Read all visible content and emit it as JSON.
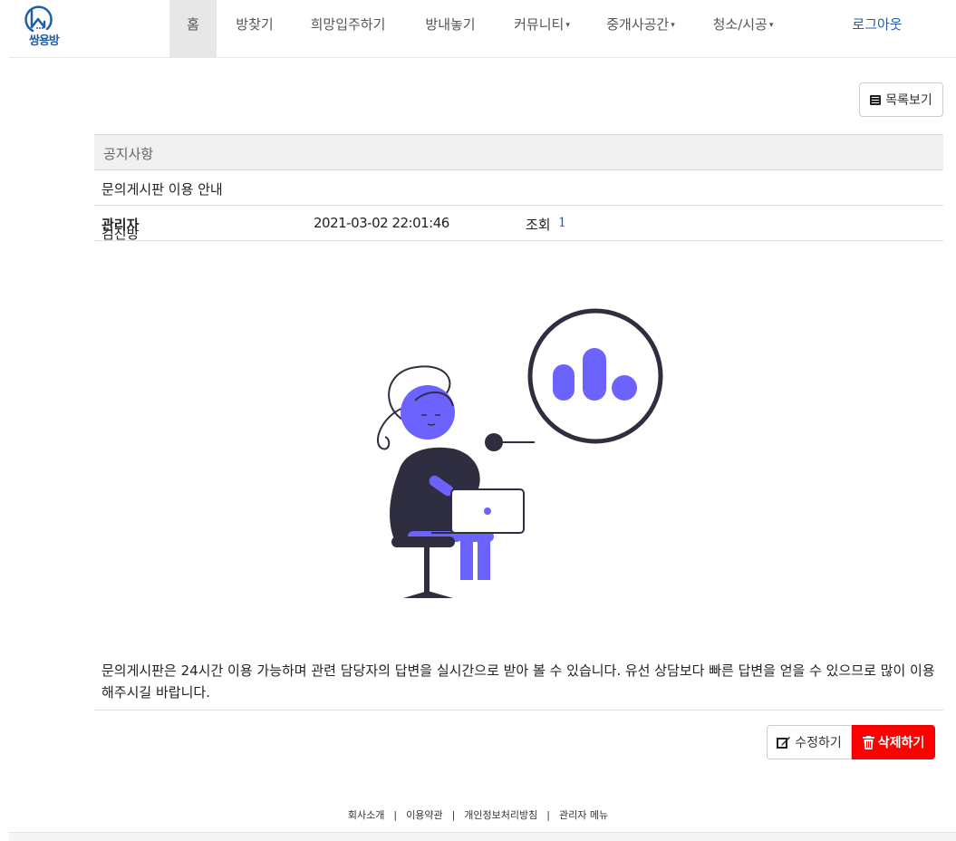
{
  "brand": {
    "name": "쌍용방",
    "accent": "#1f5fa8"
  },
  "nav": {
    "home": "홈",
    "find_room": "방찾기",
    "wish_move": "희망입주하기",
    "list_room": "방내놓기",
    "community": "커뮤니티",
    "broker_space": "중개사공간",
    "cleaning": "청소/시공",
    "logout": "로그아웃",
    "caret": "▾"
  },
  "toolbar": {
    "list_view_label": "목록보기",
    "list_icon": "list-icon"
  },
  "post": {
    "category": "공지사항",
    "title": "문의게시판 이용 안내",
    "author": "김진방",
    "author_role": "관리자",
    "date": "2021-03-02 22:01:46",
    "views_label": "조회",
    "views": "1",
    "body": "문의게시판은 24시간 이용 가능하며 관련 담당자의 답변을 실시간으로 받아 볼 수 있습니다. 유선 상담보다 빠른 답변을 얻을 수 있으므로 많이 이용해주시길 바랍니다."
  },
  "actions": {
    "edit_label": "수정하기",
    "delete_label": "삭제하기",
    "delete_color": "#ff0000",
    "illustration_accent": "#6c63ff",
    "illustration_dark": "#2f2e41"
  },
  "footer": {
    "links": [
      "회사소개",
      "이용약관",
      "개인정보처리방침",
      "관리자 메뉴"
    ],
    "separator": "|"
  }
}
